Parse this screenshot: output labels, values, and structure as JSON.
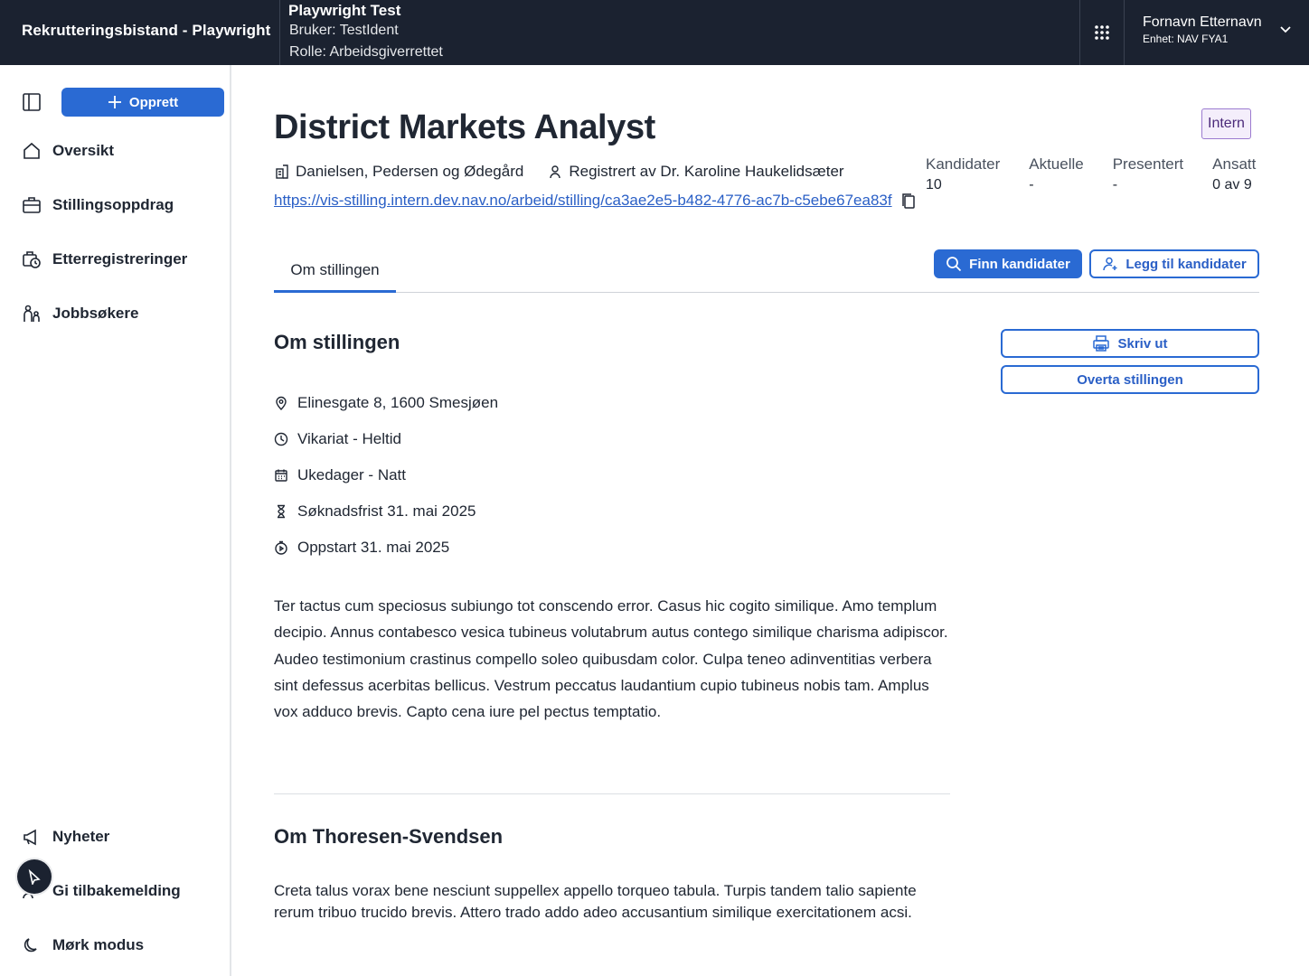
{
  "header": {
    "app_title": "Rekrutteringsbistand - Playwright",
    "env_title": "Playwright Test",
    "env_user": "Bruker: TestIdent",
    "env_role": "Rolle: Arbeidsgiverrettet",
    "user_name": "Fornavn Etternavn",
    "user_unit": "Enhet: NAV FYA1"
  },
  "sidebar": {
    "create_label": "Opprett",
    "items": [
      {
        "label": "Oversikt",
        "icon": "house-icon"
      },
      {
        "label": "Stillingsoppdrag",
        "icon": "briefcase-icon"
      },
      {
        "label": "Etterregistreringer",
        "icon": "briefcase-clock-icon"
      },
      {
        "label": "Jobbsøkere",
        "icon": "people-icon"
      }
    ],
    "bottom_items": [
      {
        "label": "Nyheter",
        "icon": "megaphone-icon"
      },
      {
        "label": "Gi tilbakemelding",
        "icon": "feedback-icon"
      },
      {
        "label": "Mørk modus",
        "icon": "moon-icon"
      }
    ]
  },
  "job": {
    "title": "District Markets Analyst",
    "badge": "Intern",
    "employer": "Danielsen, Pedersen og Ødegård",
    "registered_by": "Registrert av Dr. Karoline Haukelidsæter",
    "link": "https://vis-stilling.intern.dev.nav.no/arbeid/stilling/ca3ae2e5-b482-4776-ac7b-c5ebe67ea83f"
  },
  "stats": [
    {
      "label": "Kandidater",
      "value": "10"
    },
    {
      "label": "Aktuelle",
      "value": "-"
    },
    {
      "label": "Presentert",
      "value": "-"
    },
    {
      "label": "Ansatt",
      "value": "0 av 9"
    }
  ],
  "tabs": {
    "active": "Om stillingen"
  },
  "actions": {
    "find_candidates": "Finn kandidater",
    "add_candidates": "Legg til kandidater",
    "print": "Skriv ut",
    "take_over": "Overta stillingen"
  },
  "about": {
    "heading": "Om stillingen",
    "details": [
      {
        "text": "Elinesgate 8, 1600 Smesjøen",
        "icon": "location-pin-icon"
      },
      {
        "text": "Vikariat - Heltid",
        "icon": "clock-icon"
      },
      {
        "text": "Ukedager - Natt",
        "icon": "calendar-icon"
      },
      {
        "text": "Søknadsfrist 31. mai 2025",
        "icon": "hourglass-icon"
      },
      {
        "text": "Oppstart 31. mai 2025",
        "icon": "stopwatch-icon"
      }
    ],
    "description": "Ter tactus cum speciosus subiungo tot conscendo error. Casus hic cogito similique. Amo templum decipio. Annus contabesco vesica tubineus volutabrum autus contego similique charisma adipiscor. Audeo testimonium crastinus compello soleo quibusdam color. Culpa teneo adinventitias verbera sint defessus acerbitas bellicus. Vestrum peccatus laudantium cupio tubineus nobis tam. Amplus vox adduco brevis. Capto cena iure pel pectus temptatio."
  },
  "employer_section": {
    "heading": "Om Thoresen-Svendsen",
    "description": "Creta talus vorax bene nesciunt suppellex appello torqueo tabula. Turpis tandem talio sapiente rerum tribuo trucido brevis. Attero trado addo adeo accusantium similique exercitationem acsi."
  }
}
